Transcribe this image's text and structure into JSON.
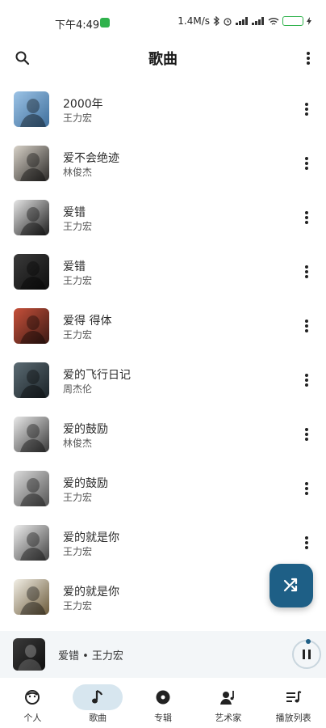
{
  "status_bar": {
    "time": "下午4:49",
    "network_speed": "1.4M/s",
    "battery_level": 0.9,
    "colors": {
      "battery": "#2fb24c"
    }
  },
  "header": {
    "title": "歌曲",
    "search_icon": "search-icon",
    "more_icon": "more-vert-icon"
  },
  "songs": [
    {
      "title": "2000年",
      "artist": "王力宏",
      "cover": [
        "#9cc3e6",
        "#3f6f9c"
      ]
    },
    {
      "title": "爱不会绝迹",
      "artist": "林俊杰",
      "cover": [
        "#d8d2c8",
        "#2c2a28"
      ]
    },
    {
      "title": "爱错",
      "artist": "王力宏",
      "cover": [
        "#e6e6e6",
        "#1d1d1d"
      ]
    },
    {
      "title": "爱错",
      "artist": "王力宏",
      "cover": [
        "#3a3a3a",
        "#0f0f0f"
      ]
    },
    {
      "title": "爱得 得体",
      "artist": "王力宏",
      "cover": [
        "#c7503a",
        "#3b1a14"
      ]
    },
    {
      "title": "爱的飞行日记",
      "artist": "周杰伦",
      "cover": [
        "#5b6b73",
        "#1b2328"
      ]
    },
    {
      "title": "爱的鼓励",
      "artist": "林俊杰",
      "cover": [
        "#e9e9e9",
        "#3a3a3a"
      ]
    },
    {
      "title": "爱的鼓励",
      "artist": "王力宏",
      "cover": [
        "#dcdcdc",
        "#555555"
      ]
    },
    {
      "title": "爱的就是你",
      "artist": "王力宏",
      "cover": [
        "#eeeeee",
        "#444444"
      ]
    },
    {
      "title": "爱的就是你",
      "artist": "王力宏",
      "cover": [
        "#f2efe6",
        "#6b5a3a"
      ]
    }
  ],
  "fab": {
    "icon": "shuffle-icon",
    "color": "#1e5f86"
  },
  "mini_player": {
    "now_playing": "爱错 • 王力宏",
    "cover": [
      "#3a3a3a",
      "#0f0f0f"
    ],
    "state_icon": "pause-icon"
  },
  "bottom_nav": {
    "active_index": 1,
    "items": [
      {
        "label": "个人",
        "icon": "face-icon"
      },
      {
        "label": "歌曲",
        "icon": "music-note-icon"
      },
      {
        "label": "专辑",
        "icon": "album-icon"
      },
      {
        "label": "艺术家",
        "icon": "artist-icon"
      },
      {
        "label": "播放列表",
        "icon": "playlist-icon"
      }
    ]
  }
}
